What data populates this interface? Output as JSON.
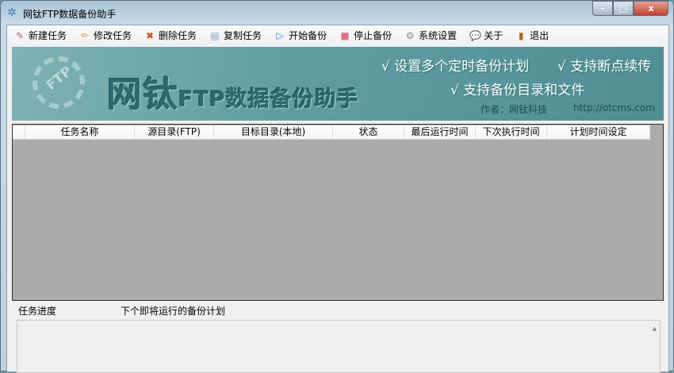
{
  "window": {
    "title": "网钛FTP数据备份助手",
    "minimize": "–",
    "maximize": "□",
    "close": "x"
  },
  "toolbar": [
    {
      "label": "新建任务",
      "icon": "new-task-icon",
      "glyph": "✎",
      "color": "#c05a7a"
    },
    {
      "label": "修改任务",
      "icon": "pencil-icon",
      "glyph": "✏",
      "color": "#e0a020"
    },
    {
      "label": "删除任务",
      "icon": "delete-icon",
      "glyph": "✖",
      "color": "#e04a1a"
    },
    {
      "label": "复制任务",
      "icon": "copy-icon",
      "glyph": "▤",
      "color": "#8aa0c0"
    },
    {
      "label": "开始备份",
      "icon": "play-icon",
      "glyph": "▷",
      "color": "#3a7fd0"
    },
    {
      "label": "停止备份",
      "icon": "stop-icon",
      "glyph": "■",
      "color": "#e0708a"
    },
    {
      "label": "系统设置",
      "icon": "gear-icon",
      "glyph": "⚙",
      "color": "#888888"
    },
    {
      "label": "关于",
      "icon": "chat-icon",
      "glyph": "💬",
      "color": "#60a0e0"
    },
    {
      "label": "退出",
      "icon": "door-icon",
      "glyph": "▮",
      "color": "#b06a20"
    }
  ],
  "banner": {
    "logo_text": "FTP",
    "title_main": "网钛",
    "title_sub": "FTP数据备份助手",
    "feature1": "√ 设置多个定时备份计划",
    "feature2": "√ 支持断点续传",
    "feature3": "√ 支持备份目录和文件",
    "author": "作者：网钛科技",
    "url": "http://otcms.com"
  },
  "table": {
    "columns": [
      "",
      "任务名称",
      "源目录(FTP)",
      "目标目录(本地)",
      "状态",
      "最后运行时间",
      "下次执行时间",
      "计划时间设定"
    ]
  },
  "lower": {
    "tab1": "任务进度",
    "tab2": "下个即将运行的备份计划"
  }
}
